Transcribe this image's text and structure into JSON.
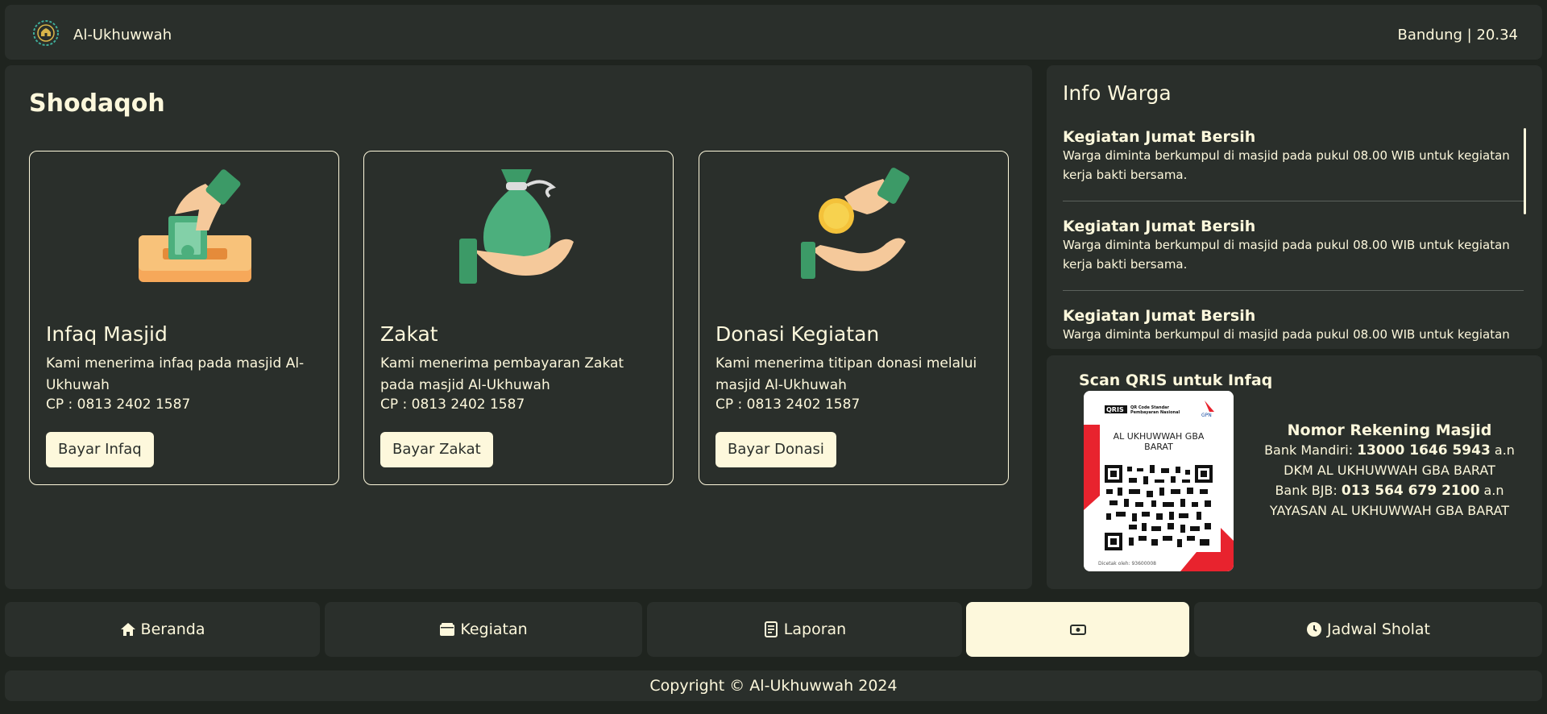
{
  "header": {
    "brand": "Al-Ukhuwwah",
    "location": "Bandung | 20.34"
  },
  "main": {
    "title": "Shodaqoh",
    "cards": [
      {
        "title": "Infaq Masjid",
        "description": "Kami menerima infaq pada masjid Al-Ukhuwah",
        "cp": "CP : 0813 2402 1587",
        "button": "Bayar Infaq",
        "icon": "hand-box-money-icon"
      },
      {
        "title": "Zakat",
        "description": "Kami menerima pembayaran Zakat pada masjid Al-Ukhuwah",
        "cp": "CP : 0813 2402 1587",
        "button": "Bayar Zakat",
        "icon": "hand-money-bag-icon"
      },
      {
        "title": "Donasi Kegiatan",
        "description": "Kami menerima titipan donasi melalui masjid Al-Ukhuwah",
        "cp": "CP : 0813 2402 1587",
        "button": "Bayar Donasi",
        "icon": "hand-coin-icon"
      }
    ]
  },
  "info": {
    "title": "Info Warga",
    "items": [
      {
        "title": "Kegiatan Jumat Bersih",
        "description": "Warga diminta berkumpul di masjid pada pukul 08.00 WIB untuk kegiatan kerja bakti bersama."
      },
      {
        "title": "Kegiatan Jumat Bersih",
        "description": "Warga diminta berkumpul di masjid pada pukul 08.00 WIB untuk kegiatan kerja bakti bersama."
      },
      {
        "title": "Kegiatan Jumat Bersih",
        "description": "Warga diminta berkumpul di masjid pada pukul 08.00 WIB untuk kegiatan kerja bakti bersama."
      }
    ]
  },
  "qris": {
    "label": "Scan QRIS untuk Infaq",
    "logo_text": "QRIS",
    "standard_text": "QR Code Standar Pembayaran Nasional",
    "gpn_text": "GPN",
    "merchant": "AL UKHUWWAH GBA BARAT",
    "printed_by": "Dicetak oleh: 93600008"
  },
  "rekening": {
    "title": "Nomor Rekening Masjid",
    "mandiri_prefix": "Bank Mandiri: ",
    "mandiri_number": "13000 1646 5943",
    "mandiri_suffix": " a.n",
    "mandiri_name": "DKM AL UKHUWWAH GBA BARAT",
    "bjb_prefix": "Bank BJB: ",
    "bjb_number": "013 564 679 2100",
    "bjb_suffix": " a.n",
    "bjb_name": "YAYASAN AL UKHUWWAH GBA BARAT"
  },
  "nav": {
    "beranda": "Beranda",
    "kegiatan": "Kegiatan",
    "laporan": "Laporan",
    "jadwal": "Jadwal Sholat"
  },
  "footer": {
    "copyright": "Copyright © Al-Ukhuwwah 2024"
  },
  "colors": {
    "background": "#1f241f",
    "panel": "#2a2f2b",
    "accent": "#fdf8dc",
    "green": "#4caf7d",
    "skin": "#f5c99b"
  }
}
